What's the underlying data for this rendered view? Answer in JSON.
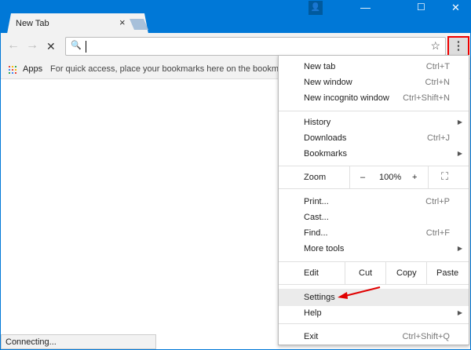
{
  "tab": {
    "title": "New Tab",
    "close": "×"
  },
  "window": {
    "profile": "👤",
    "minimize": "—",
    "maximize": "☐",
    "close": "✕"
  },
  "toolbar": {
    "back": "←",
    "forward": "→",
    "stop": "✕",
    "search_icon": "🔍",
    "star": "☆",
    "menu": "⋮",
    "omnibox_value": ""
  },
  "bookmarks": {
    "apps_label": "Apps",
    "hint": "For quick access, place your bookmarks here on the bookmarks bar.",
    "apps_colors": [
      "#ea4335",
      "#fbbc05",
      "#34a853",
      "#4285f4",
      "#ea4335",
      "#fbbc05",
      "#34a853",
      "#4285f4",
      "#ea4335"
    ]
  },
  "status": "Connecting...",
  "menu": {
    "group1": [
      {
        "label": "New tab",
        "shortcut": "Ctrl+T"
      },
      {
        "label": "New window",
        "shortcut": "Ctrl+N"
      },
      {
        "label": "New incognito window",
        "shortcut": "Ctrl+Shift+N"
      }
    ],
    "group2": [
      {
        "label": "History",
        "shortcut": ""
      },
      {
        "label": "Downloads",
        "shortcut": "Ctrl+J"
      },
      {
        "label": "Bookmarks",
        "shortcut": ""
      }
    ],
    "zoom": {
      "label": "Zoom",
      "minus": "–",
      "value": "100%",
      "plus": "+",
      "fullscreen": "⛶"
    },
    "group3": [
      {
        "label": "Print...",
        "shortcut": "Ctrl+P"
      },
      {
        "label": "Cast...",
        "shortcut": ""
      },
      {
        "label": "Find...",
        "shortcut": "Ctrl+F"
      },
      {
        "label": "More tools",
        "shortcut": ""
      }
    ],
    "edit": {
      "label": "Edit",
      "cut": "Cut",
      "copy": "Copy",
      "paste": "Paste"
    },
    "settings": "Settings",
    "help": "Help",
    "exit": {
      "label": "Exit",
      "shortcut": "Ctrl+Shift+Q"
    },
    "submenu_arrow": "▶"
  },
  "annotation_color": "#e00000"
}
